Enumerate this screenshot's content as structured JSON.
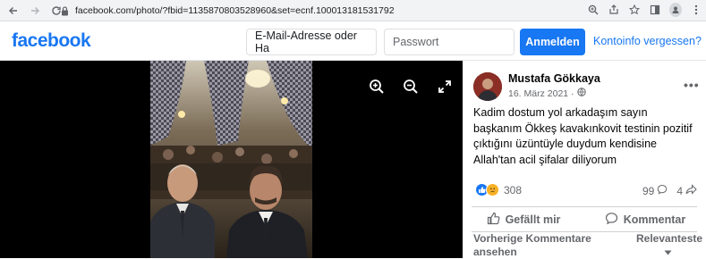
{
  "browser": {
    "url": "facebook.com/photo/?fbid=1135870803528960&set=ecnf.100013181531792",
    "icons": [
      "back-arrow",
      "forward-arrow",
      "reload",
      "lock",
      "zoom",
      "share",
      "star",
      "sidebar",
      "profile",
      "menu"
    ]
  },
  "header": {
    "logo": "facebook",
    "email_placeholder": "E-Mail-Adresse oder Ha",
    "password_placeholder": "Passwort",
    "login_label": "Anmelden",
    "forgot_label": "Kontoinfo vergessen?"
  },
  "viewer": {
    "icons": [
      "zoom-in",
      "zoom-out",
      "fullscreen"
    ]
  },
  "post": {
    "author": "Mustafa Gökkaya",
    "date": "16. März 2021 ·",
    "text": "Kadim dostum yol arkadaşım sayın başkanım Ökkeş kavakınkovit testinin pozitif çıktığını üzüntüyle duydum kendisine Allah'tan acil şifalar diliyorum",
    "reaction_count": "308",
    "comments_count": "99",
    "shares_count": "4",
    "like_label": "Gefällt mir",
    "comment_label": "Kommentar",
    "previous_comments_label": "Vorherige Kommentare ansehen",
    "sort_label": "Relevanteste"
  },
  "colors": {
    "brand": "#1877f2",
    "viewer_bg": "#000000",
    "sad_reaction": "#f7b125"
  }
}
